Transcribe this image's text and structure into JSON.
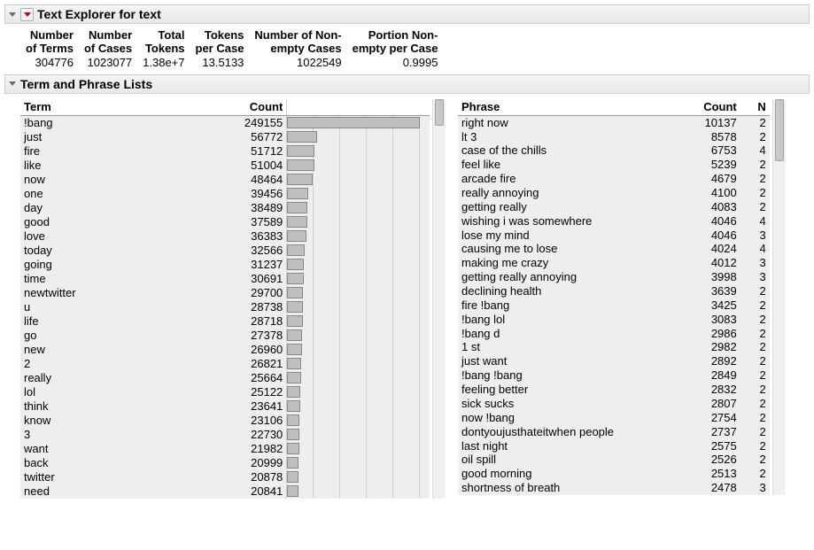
{
  "header1": {
    "title": "Text Explorer for text"
  },
  "stats": {
    "h1a": "Number",
    "h1b": "of Terms",
    "h2a": "Number",
    "h2b": "of Cases",
    "h3a": "Total",
    "h3b": "Tokens",
    "h4a": "Tokens",
    "h4b": "per Case",
    "h5a": "Number of Non-",
    "h5b": "empty Cases",
    "h6a": "Portion Non-",
    "h6b": "empty per Case",
    "v1": "304776",
    "v2": "1023077",
    "v3": "1.38e+7",
    "v4": "13.5133",
    "v5": "1022549",
    "v6": "0.9995"
  },
  "header2": {
    "title": "Term and Phrase Lists"
  },
  "cols": {
    "term": "Term",
    "count": "Count",
    "phrase": "Phrase",
    "pcount": "Count",
    "n": "N"
  },
  "maxCount": 249155,
  "terms": [
    {
      "term": "!bang",
      "count": 249155
    },
    {
      "term": "just",
      "count": 56772
    },
    {
      "term": "fire",
      "count": 51712
    },
    {
      "term": "like",
      "count": 51004
    },
    {
      "term": "now",
      "count": 48464
    },
    {
      "term": "one",
      "count": 39456
    },
    {
      "term": "day",
      "count": 38489
    },
    {
      "term": "good",
      "count": 37589
    },
    {
      "term": "love",
      "count": 36383
    },
    {
      "term": "today",
      "count": 32566
    },
    {
      "term": "going",
      "count": 31237
    },
    {
      "term": "time",
      "count": 30691
    },
    {
      "term": "newtwitter",
      "count": 29700
    },
    {
      "term": "u",
      "count": 28738
    },
    {
      "term": "life",
      "count": 28718
    },
    {
      "term": "go",
      "count": 27378
    },
    {
      "term": "new",
      "count": 26960
    },
    {
      "term": "2",
      "count": 26821
    },
    {
      "term": "really",
      "count": 25664
    },
    {
      "term": "lol",
      "count": 25122
    },
    {
      "term": "think",
      "count": 23641
    },
    {
      "term": "know",
      "count": 23106
    },
    {
      "term": "3",
      "count": 22730
    },
    {
      "term": "want",
      "count": 21982
    },
    {
      "term": "back",
      "count": 20999
    },
    {
      "term": "twitter",
      "count": 20878
    },
    {
      "term": "need",
      "count": 20841
    }
  ],
  "phrases": [
    {
      "phrase": "right now",
      "count": 10137,
      "n": 2
    },
    {
      "phrase": "lt 3",
      "count": 8578,
      "n": 2
    },
    {
      "phrase": "case of the chills",
      "count": 6753,
      "n": 4
    },
    {
      "phrase": "feel like",
      "count": 5239,
      "n": 2
    },
    {
      "phrase": "arcade fire",
      "count": 4679,
      "n": 2
    },
    {
      "phrase": "really annoying",
      "count": 4100,
      "n": 2
    },
    {
      "phrase": "getting really",
      "count": 4083,
      "n": 2
    },
    {
      "phrase": "wishing i was somewhere",
      "count": 4046,
      "n": 4
    },
    {
      "phrase": "lose my mind",
      "count": 4046,
      "n": 3
    },
    {
      "phrase": "causing me to lose",
      "count": 4024,
      "n": 4
    },
    {
      "phrase": "making me crazy",
      "count": 4012,
      "n": 3
    },
    {
      "phrase": "getting really annoying",
      "count": 3998,
      "n": 3
    },
    {
      "phrase": "declining health",
      "count": 3639,
      "n": 2
    },
    {
      "phrase": "fire !bang",
      "count": 3425,
      "n": 2
    },
    {
      "phrase": "!bang lol",
      "count": 3083,
      "n": 2
    },
    {
      "phrase": "!bang d",
      "count": 2986,
      "n": 2
    },
    {
      "phrase": "1 st",
      "count": 2982,
      "n": 2
    },
    {
      "phrase": "just want",
      "count": 2892,
      "n": 2
    },
    {
      "phrase": "!bang !bang",
      "count": 2849,
      "n": 2
    },
    {
      "phrase": "feeling better",
      "count": 2832,
      "n": 2
    },
    {
      "phrase": "sick sucks",
      "count": 2807,
      "n": 2
    },
    {
      "phrase": "now !bang",
      "count": 2754,
      "n": 2
    },
    {
      "phrase": "dontyoujusthateitwhen people",
      "count": 2737,
      "n": 2
    },
    {
      "phrase": "last night",
      "count": 2575,
      "n": 2
    },
    {
      "phrase": "oil spill",
      "count": 2526,
      "n": 2
    },
    {
      "phrase": "good morning",
      "count": 2513,
      "n": 2
    },
    {
      "phrase": "shortness of breath",
      "count": 2478,
      "n": 3
    }
  ]
}
